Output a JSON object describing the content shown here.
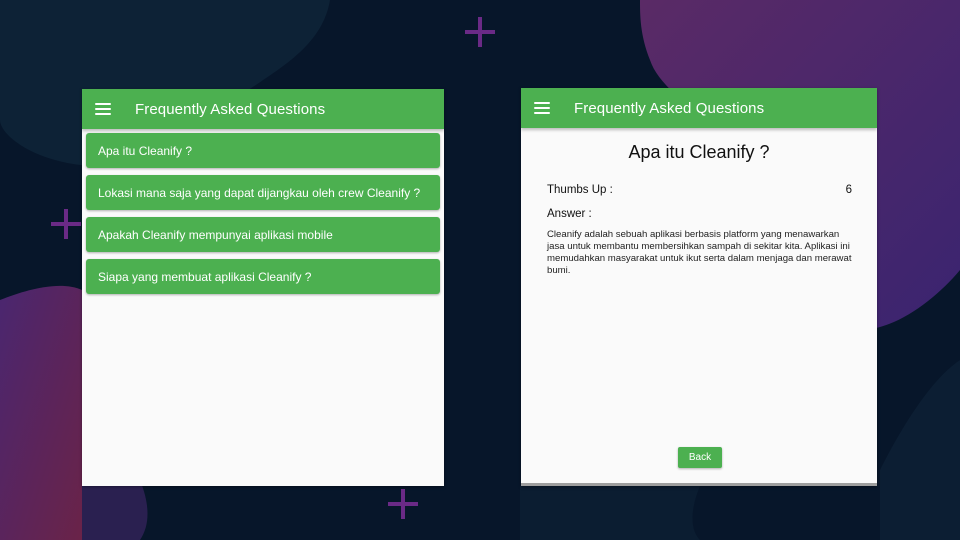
{
  "colors": {
    "background": "#07162a",
    "app_bar": "#4cb050",
    "card": "#4cb050",
    "surface": "#fafafa",
    "accent_plus": "#6a2a86"
  },
  "list_screen": {
    "title": "Frequently Asked Questions",
    "menu_icon": "hamburger-menu-icon",
    "items": [
      {
        "label": "Apa itu Cleanify ?"
      },
      {
        "label": "Lokasi mana saja yang dapat dijangkau oleh crew Cleanify ?"
      },
      {
        "label": "Apakah Cleanify mempunyai aplikasi mobile"
      },
      {
        "label": "Siapa yang membuat aplikasi Cleanify ?"
      }
    ]
  },
  "detail_screen": {
    "title": "Frequently Asked Questions",
    "menu_icon": "hamburger-menu-icon",
    "question": "Apa itu Cleanify ?",
    "thumbs_label": "Thumbs Up :",
    "thumbs_value": "6",
    "answer_label": "Answer :",
    "answer_text": "Cleanify adalah sebuah aplikasi berbasis platform yang menawarkan jasa untuk membantu membersihkan sampah di sekitar kita. Aplikasi ini memudahkan masyarakat untuk ikut serta dalam menjaga dan merawat bumi.",
    "back_label": "Back"
  }
}
